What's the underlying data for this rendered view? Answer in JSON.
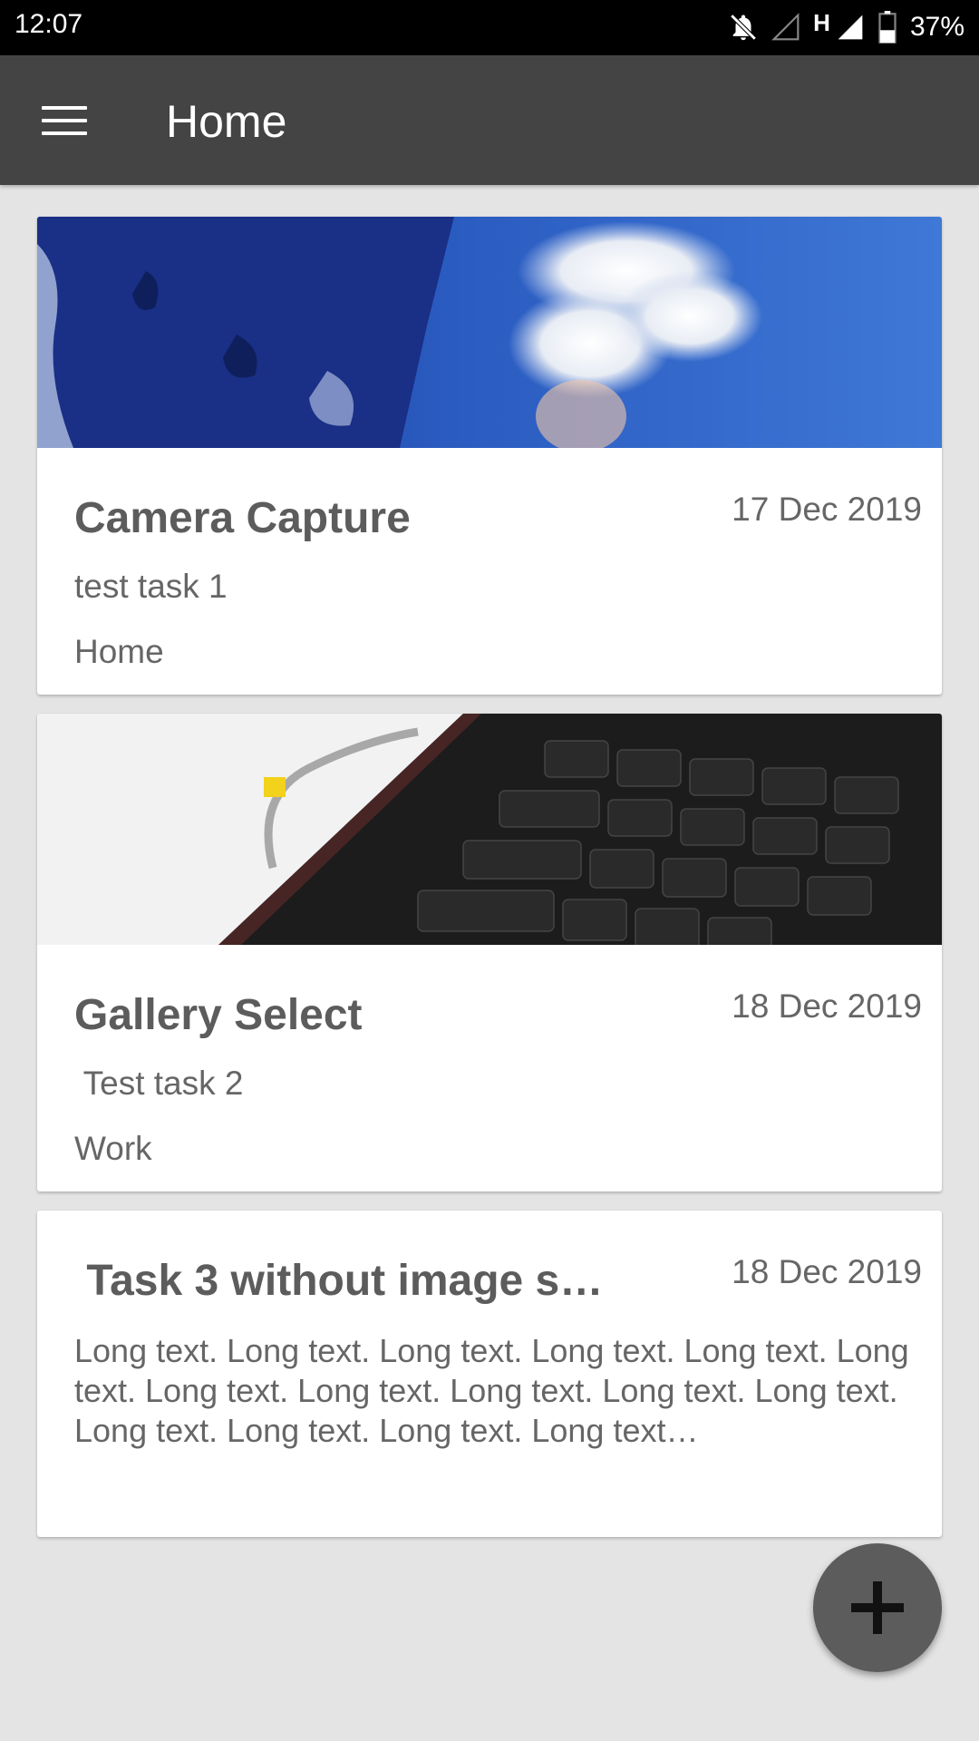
{
  "status_bar": {
    "time": "12:07",
    "network_type": "H",
    "battery_percent": "37%",
    "icons": [
      "notifications-off-icon",
      "signal-empty-icon",
      "signal-full-icon",
      "battery-icon"
    ]
  },
  "app_bar": {
    "title": "Home",
    "menu_icon": "hamburger-menu-icon"
  },
  "tasks": [
    {
      "title": "Camera Capture",
      "date": "17 Dec 2019",
      "description": "test task 1",
      "category": "Home",
      "image": "sky-clouds-photo"
    },
    {
      "title": "Gallery Select",
      "date": "18 Dec 2019",
      "description": " Test task 2",
      "category": "Work",
      "image": "laptop-keyboard-photo"
    },
    {
      "title": " Task 3 without image s…",
      "date": "18 Dec 2019",
      "description": "Long text. Long text. Long text. Long text. Long text. Long text. Long text. Long text. Long text. Long text. Long text. Long text. Long text. Long text. Long text…"
    }
  ],
  "fab": {
    "icon": "plus-icon"
  },
  "colors": {
    "status_bar": "#000000",
    "app_bar": "#444444",
    "background": "#e4e4e4",
    "card": "#ffffff",
    "fab": "#5c5c5c"
  }
}
